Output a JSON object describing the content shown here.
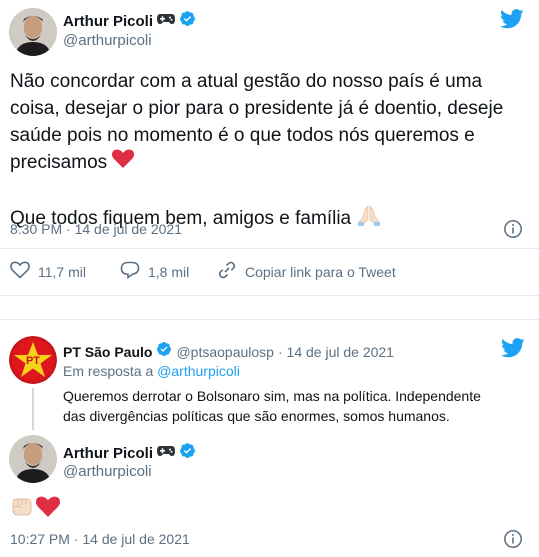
{
  "tweet_main": {
    "author_name": "Arthur Picoli",
    "author_handle": "@arthurpicoli",
    "text_line1": "Não concordar com a atual gestão do nosso país é uma",
    "text_line2": "coisa, desejar o pior para o presidente já é doentio, deseje",
    "text_line3": "saúde pois no momento é o que todos nós queremos e",
    "text_line4": "precisamos",
    "text_line5": "Que todos fiquem bem, amigos e família",
    "timestamp": "8:30 PM · 14 de jul de 2021",
    "likes": "11,7 mil",
    "replies": "1,8 mil",
    "copy_link": "Copiar link para o Tweet"
  },
  "quoted_tweet": {
    "author_name": "PT São Paulo",
    "author_handle": "@ptsaopaulosp",
    "date": "· 14 de jul de 2021",
    "reply_prefix": "Em resposta a ",
    "reply_handle": "@arthurpicoli",
    "text_line1": "Queremos derrotar o Bolsonaro sim, mas na política. Independente",
    "text_line2": "das divergências políticas que são enormes, somos  humanos."
  },
  "reply_tweet": {
    "author_name": "Arthur Picoli",
    "author_handle": "@arthurpicoli",
    "timestamp": "10:27 PM · 14 de jul de 2021"
  },
  "colors": {
    "twitter_blue": "#1da1f2",
    "text": "#0f1419",
    "secondary": "#5b7083",
    "pt_red": "#d7141a",
    "heart": "#e0245e"
  },
  "icons": {
    "verified": "verified-badge-icon",
    "gamepad": "gamepad-icon",
    "bird": "twitter-bird-icon",
    "heart": "heart-outline-icon",
    "reply": "reply-bubble-icon",
    "link": "link-icon",
    "info": "info-icon"
  }
}
